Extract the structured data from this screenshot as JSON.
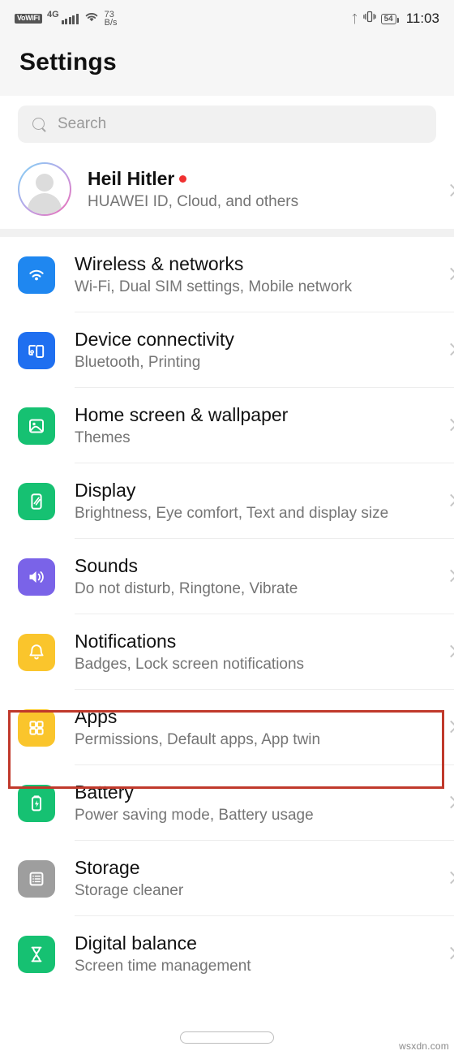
{
  "statusbar": {
    "vowifi": "VoWiFi",
    "network": "4G",
    "data_speed_value": "73",
    "data_speed_unit": "B/s",
    "battery": "54",
    "time": "11:03",
    "icons": [
      "vowifi-icon",
      "signal-bars-icon",
      "wifi-icon",
      "bluetooth-icon",
      "vibrate-icon",
      "battery-icon"
    ]
  },
  "header": {
    "title": "Settings"
  },
  "search": {
    "placeholder": "Search",
    "icon": "search-icon"
  },
  "profile": {
    "name": "Heil Hitler",
    "subtitle": "HUAWEI ID, Cloud, and others",
    "has_badge": true,
    "avatar": "avatar-placeholder-icon"
  },
  "list": {
    "items": [
      {
        "title": "Wireless & networks",
        "subtitle": "Wi-Fi, Dual SIM settings, Mobile network",
        "icon": "wifi-icon",
        "color": "#1f87f0",
        "highlighted": false
      },
      {
        "title": "Device connectivity",
        "subtitle": "Bluetooth, Printing",
        "icon": "device-connectivity-icon",
        "color": "#1f6ff0",
        "highlighted": false
      },
      {
        "title": "Home screen & wallpaper",
        "subtitle": "Themes",
        "icon": "image-icon",
        "color": "#16c172",
        "highlighted": false
      },
      {
        "title": "Display",
        "subtitle": "Brightness, Eye comfort, Text and display size",
        "icon": "phone-display-icon",
        "color": "#16c172",
        "highlighted": false
      },
      {
        "title": "Sounds",
        "subtitle": "Do not disturb, Ringtone, Vibrate",
        "icon": "speaker-icon",
        "color": "#7a63e8",
        "highlighted": false
      },
      {
        "title": "Notifications",
        "subtitle": "Badges, Lock screen notifications",
        "icon": "bell-icon",
        "color": "#fac52c",
        "highlighted": false
      },
      {
        "title": "Apps",
        "subtitle": "Permissions, Default apps, App twin",
        "icon": "grid-apps-icon",
        "color": "#fac52c",
        "highlighted": true
      },
      {
        "title": "Battery",
        "subtitle": "Power saving mode, Battery usage",
        "icon": "battery-icon",
        "color": "#16c172",
        "highlighted": false
      },
      {
        "title": "Storage",
        "subtitle": "Storage cleaner",
        "icon": "storage-list-icon",
        "color": "#9e9e9e",
        "highlighted": false
      },
      {
        "title": "Digital balance",
        "subtitle": "Screen time management",
        "icon": "hourglass-icon",
        "color": "#16c172",
        "highlighted": false
      }
    ]
  },
  "highlight": {
    "color": "#c0392b",
    "target": "Apps"
  },
  "watermark": {
    "text": "wsxdn.com"
  },
  "navbar": {
    "pill": "home-gesture-pill"
  }
}
